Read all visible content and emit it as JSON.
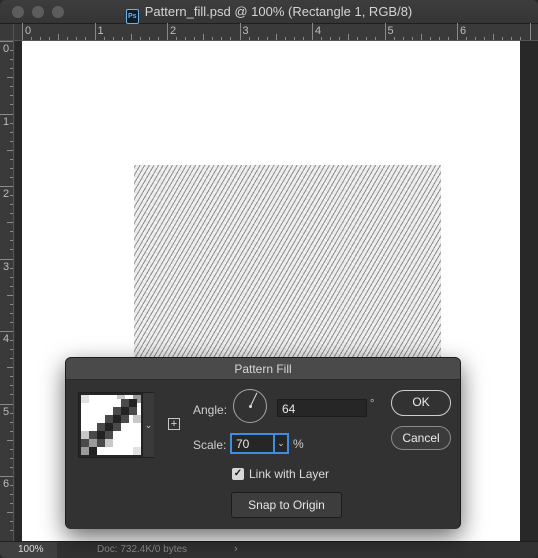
{
  "window": {
    "title": "Pattern_fill.psd @ 100% (Rectangle 1, RGB/8)",
    "app_badge": "Ps"
  },
  "rulers": {
    "horizontal_labels": [
      "0",
      "1",
      "2",
      "3",
      "4",
      "5",
      "6"
    ],
    "vertical_labels": [
      "0",
      "1",
      "2",
      "3",
      "4",
      "5",
      "6"
    ]
  },
  "statusbar": {
    "zoom": "100%",
    "doc_info": "Doc: 732.4K/0 bytes",
    "arrow": "›"
  },
  "dialog": {
    "title": "Pattern Fill",
    "angle_label": "Angle:",
    "angle_value": "64",
    "angle_unit": "°",
    "scale_label": "Scale:",
    "scale_value": "70",
    "scale_unit": "%",
    "link_with_layer_label": "Link with Layer",
    "link_with_layer_checked": true,
    "snap_to_origin_label": "Snap to Origin",
    "ok_label": "OK",
    "cancel_label": "Cancel"
  },
  "icons": {
    "dropdown": "chevron-down-icon",
    "add_preset": "add-preset-icon",
    "angle_dial": "angle-dial-icon",
    "checkbox": "checkmark-icon"
  },
  "colors": {
    "focus_ring": "#3d8ee0",
    "dialog_bg": "#323232",
    "canvas": "#ffffff"
  }
}
